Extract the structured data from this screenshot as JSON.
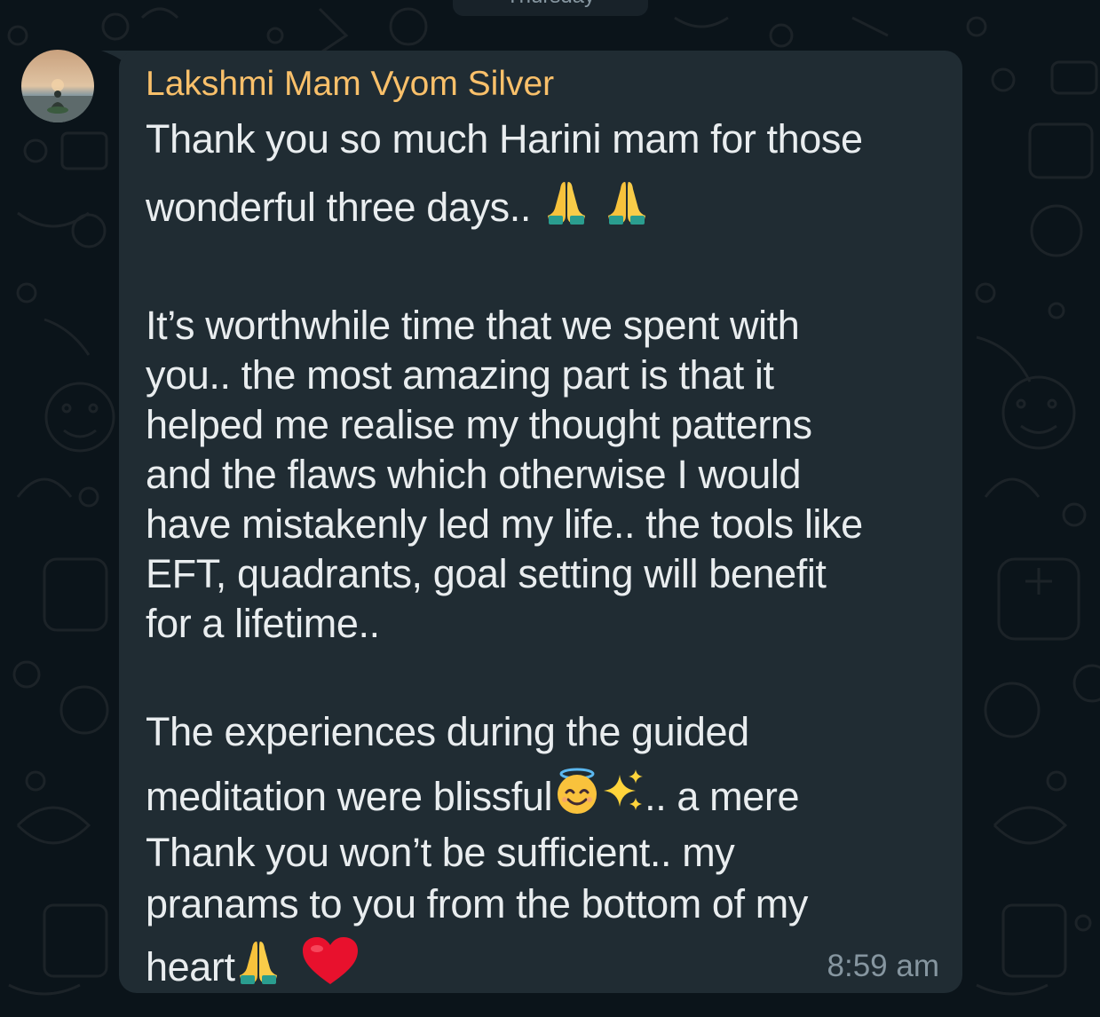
{
  "date_chip": "Thursday",
  "message": {
    "sender": "Lakshmi Mam Vyom Silver",
    "lines": [
      "Thank you so much Harini mam for those",
      "wonderful three days.. ",
      "It’s worthwhile time that we spent with",
      "you.. the most amazing part is that it",
      "helped me realise my thought patterns",
      "and the flaws which otherwise I would",
      "have mistakenly led my life.. the tools like",
      "EFT, quadrants, goal setting will benefit",
      "for a lifetime..",
      "The experiences during the guided",
      "meditation were blissful",
      ".. a mere",
      "Thank you won’t be sufficient.. my",
      "pranams to you from the bottom of my",
      "heart"
    ],
    "time": "8:59 am"
  },
  "emoji_icons": [
    "folded-hands-icon",
    "smiling-face-with-halo-icon",
    "sparkles-icon",
    "red-heart-icon"
  ],
  "colors": {
    "background": "#0b141a",
    "bubble": "#202c33",
    "sender_name": "#f9c06a",
    "text": "#e9edef",
    "timestamp": "#8696a0"
  }
}
